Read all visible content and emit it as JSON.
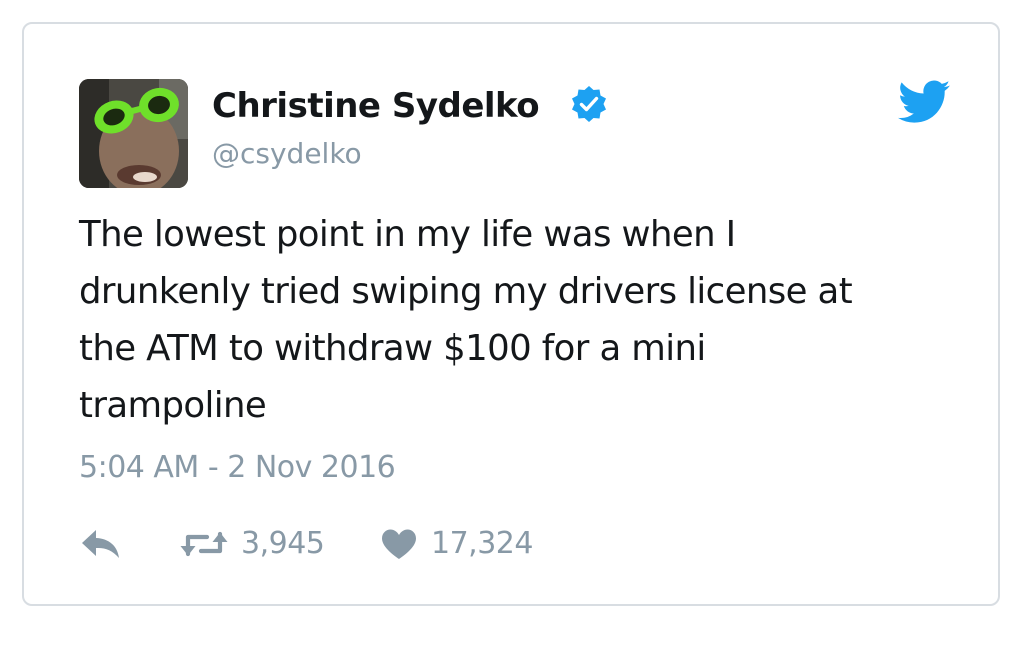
{
  "tweet": {
    "author": {
      "display_name": "Christine Sydelko",
      "handle": "@csydelko",
      "verified": true
    },
    "text": "The lowest point in my life was when I\ndrunkenly tried swiping my drivers license at\nthe ATM to withdraw $100 for a mini\ntrampoline",
    "timestamp": "5:04 AM - 2 Nov 2016",
    "retweet_count": "3,945",
    "like_count": "17,324"
  },
  "icons": {
    "verified": "verified-badge-icon",
    "brand": "twitter-bird-icon",
    "reply": "reply-icon",
    "retweet": "retweet-icon",
    "like": "heart-icon"
  },
  "colors": {
    "brand": "#1da1f2",
    "text": "#14171a",
    "muted": "#8899a6",
    "border": "#d8dde2"
  }
}
